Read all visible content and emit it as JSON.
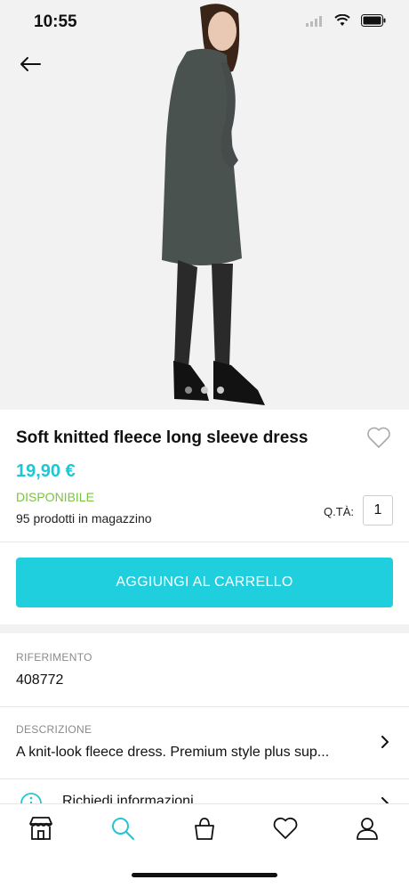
{
  "status": {
    "time": "10:55"
  },
  "product": {
    "title": "Soft knitted fleece long sleeve dress",
    "price": "19,90 €",
    "availability": "DISPONIBILE",
    "stock": "95 prodotti in magazzino",
    "qty_label": "Q.TÀ:",
    "qty_value": "1"
  },
  "actions": {
    "add_to_cart": "AGGIUNGI AL CARRELLO"
  },
  "details": {
    "reference_label": "RIFERIMENTO",
    "reference_value": "408772",
    "description_label": "DESCRIZIONE",
    "description_value": "A knit-look fleece dress. Premium style plus sup...",
    "info_label": "Richiedi informazioni"
  },
  "tabs": [
    "store-icon",
    "search-icon",
    "bag-icon",
    "heart-icon",
    "user-icon"
  ],
  "colors": {
    "accent": "#1fcfdd",
    "available": "#7cc243",
    "active_tab": "#1fc7d4"
  }
}
